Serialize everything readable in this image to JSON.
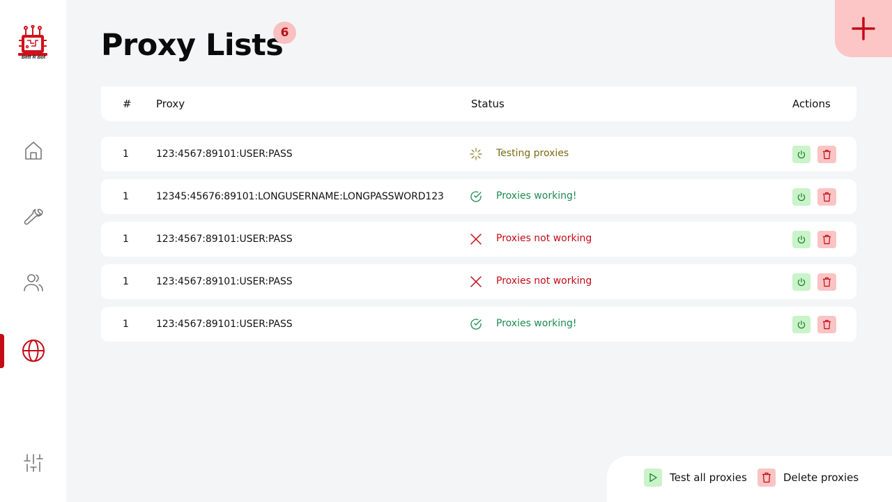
{
  "app": {
    "brand_text": "Bett R Bot",
    "accent_color": "#c40b16"
  },
  "sidebar": {
    "items": [
      {
        "icon": "home-icon",
        "active": false
      },
      {
        "icon": "wrench-icon",
        "active": false
      },
      {
        "icon": "users-icon",
        "active": false
      },
      {
        "icon": "globe-icon",
        "active": true
      },
      {
        "icon": "sliders-icon",
        "active": false
      }
    ]
  },
  "header": {
    "title": "Proxy Lists",
    "count": "6",
    "add_icon": "plus-icon"
  },
  "table": {
    "columns": [
      "#",
      "Proxy",
      "Status",
      "Actions"
    ],
    "rows": [
      {
        "num": "1",
        "proxy": "123:4567:89101:USER:PASS",
        "status": "Testing proxies",
        "status_type": "testing"
      },
      {
        "num": "1",
        "proxy": "12345:45676:89101:LONGUSERNAME:LONGPASSWORD123",
        "status": "Proxies working!",
        "status_type": "ok"
      },
      {
        "num": "1",
        "proxy": "123:4567:89101:USER:PASS",
        "status": "Proxies not working",
        "status_type": "bad"
      },
      {
        "num": "1",
        "proxy": "123:4567:89101:USER:PASS",
        "status": "Proxies not working",
        "status_type": "bad"
      },
      {
        "num": "1",
        "proxy": "123:4567:89101:USER:PASS",
        "status": "Proxies working!",
        "status_type": "ok"
      }
    ]
  },
  "bottom_bar": {
    "test_all_label": "Test all proxies",
    "delete_label": "Delete proxies"
  }
}
